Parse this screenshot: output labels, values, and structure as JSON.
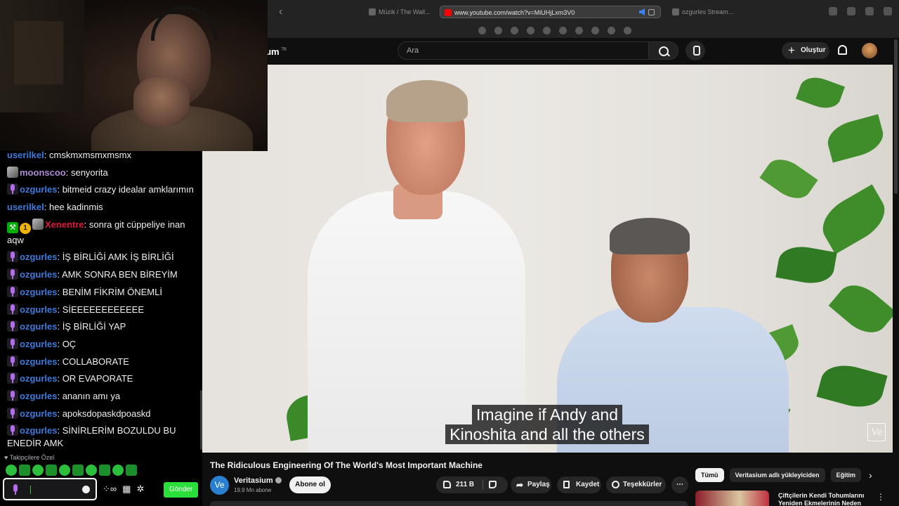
{
  "browser": {
    "tabs": [
      {
        "label": "Müzik / The Wall..."
      },
      {
        "label": "www.youtube.com/watch?v=MiUHjLxm3V0"
      },
      {
        "label": "ozgurles Stream..."
      }
    ]
  },
  "youtube": {
    "logo_fragment": "ium",
    "logo_tr": "TR",
    "search_placeholder": "Ara",
    "create_label": "Oluştur",
    "video": {
      "subtitle_line1": "Imagine if Andy and",
      "subtitle_line2": "Kinoshita and all the others",
      "watermark": "Ve",
      "title": "The Ridiculous Engineering Of The World's Most Important Machine"
    },
    "channel": {
      "avatar_text": "Ve",
      "name": "Veritasium",
      "subscribers": "19,9 Mn abone",
      "subscribe_label": "Abone ol"
    },
    "actions": {
      "like_count": "211 B",
      "share": "Paylaş",
      "save": "Kaydet",
      "thanks": "Teşekkürler",
      "more": "⋯"
    },
    "chips": [
      "Tümü",
      "Veritasium adlı yükleyiciden",
      "Eğitim"
    ],
    "recommendation": {
      "title": "Çiftçilerin Kendi Tohumlarını Yeniden Ekmelerinin Neden"
    }
  },
  "chat": {
    "messages": [
      {
        "user": "userilkel",
        "text": ": cmskmxmsmxmsmx",
        "color": "blue",
        "badges": []
      },
      {
        "user": "moonscoo",
        "text": ": senyorita",
        "color": "lavender",
        "badges": [
          "img"
        ]
      },
      {
        "user": "ozgurles",
        "text": ": bitmeid crazy idealar amklarımın",
        "color": "blue",
        "badges": [
          "mic"
        ]
      },
      {
        "user": "userilkel",
        "text": ": hee kadinmis",
        "color": "blue",
        "badges": []
      },
      {
        "user": "Xenentre",
        "text": ": sonra git cüppeliye inan aqw",
        "color": "red",
        "badges": [
          "mod",
          "sub",
          "img"
        ]
      },
      {
        "user": "ozgurles",
        "text": ": İŞ BİRLİĞİ AMK İŞ BİRLİĞİ",
        "color": "blue",
        "badges": [
          "mic"
        ]
      },
      {
        "user": "ozgurles",
        "text": ": AMK SONRA BEN BİREYİM",
        "color": "blue",
        "badges": [
          "mic"
        ]
      },
      {
        "user": "ozgurles",
        "text": ": BENİM FİKRİM ÖNEMLİ",
        "color": "blue",
        "badges": [
          "mic"
        ]
      },
      {
        "user": "ozgurles",
        "text": ": SİEEEEEEEEEEEE",
        "color": "blue",
        "badges": [
          "mic"
        ]
      },
      {
        "user": "ozgurles",
        "text": ": İŞ BİRLİĞİ YAP",
        "color": "blue",
        "badges": [
          "mic"
        ]
      },
      {
        "user": "ozgurles",
        "text": ": OÇ",
        "color": "blue",
        "badges": [
          "mic"
        ]
      },
      {
        "user": "ozgurles",
        "text": ": COLLABORATE",
        "color": "blue",
        "badges": [
          "mic"
        ]
      },
      {
        "user": "ozgurles",
        "text": ": OR EVAPORATE",
        "color": "blue",
        "badges": [
          "mic"
        ]
      },
      {
        "user": "ozgurles",
        "text": ": ananın amı ya",
        "color": "blue",
        "badges": [
          "mic"
        ]
      },
      {
        "user": "ozgurles",
        "text": ": apoksdopaskdpoaskd",
        "color": "blue",
        "badges": [
          "mic"
        ]
      },
      {
        "user": "ozgurles",
        "text": ": SİNİRLERİM BOZULDU BU ENEDİR AMK",
        "color": "blue",
        "badges": [
          "mic"
        ]
      }
    ],
    "follower_only": "Takipçilere Özel",
    "send_label": "Gönder",
    "input_value": ""
  }
}
